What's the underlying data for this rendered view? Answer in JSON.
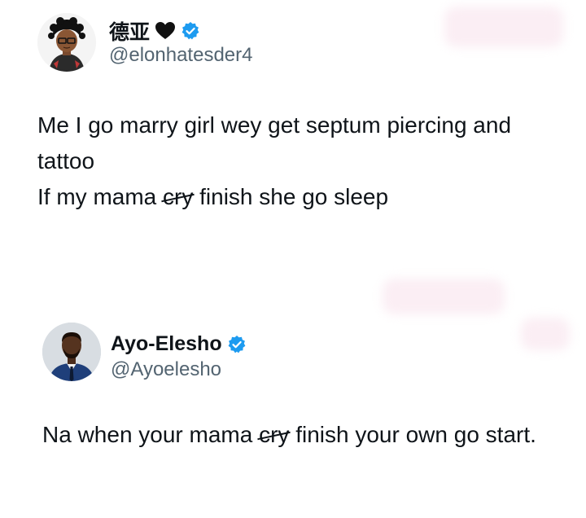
{
  "tweet1": {
    "display_name": "德亚",
    "handle": "@elonhatesder4",
    "text_line1": "Me I go marry girl wey get septum piercing and",
    "text_line2": "tattoo",
    "text_line3_before": "If my mama ",
    "text_line3_struck": "cry",
    "text_line3_after": " finish she go sleep",
    "heart_icon": "black-heart-icon",
    "verified_icon": "verified-badge-icon"
  },
  "tweet2": {
    "display_name": "Ayo-Elesho",
    "handle": "@Ayoelesho",
    "text_before": "Na when your mama ",
    "text_struck": "cry",
    "text_after": " finish your own go start.",
    "verified_icon": "verified-badge-icon"
  },
  "colors": {
    "text": "#0f1419",
    "secondary": "#536471",
    "verified": "#1d9bf0",
    "background": "#ffffff"
  }
}
